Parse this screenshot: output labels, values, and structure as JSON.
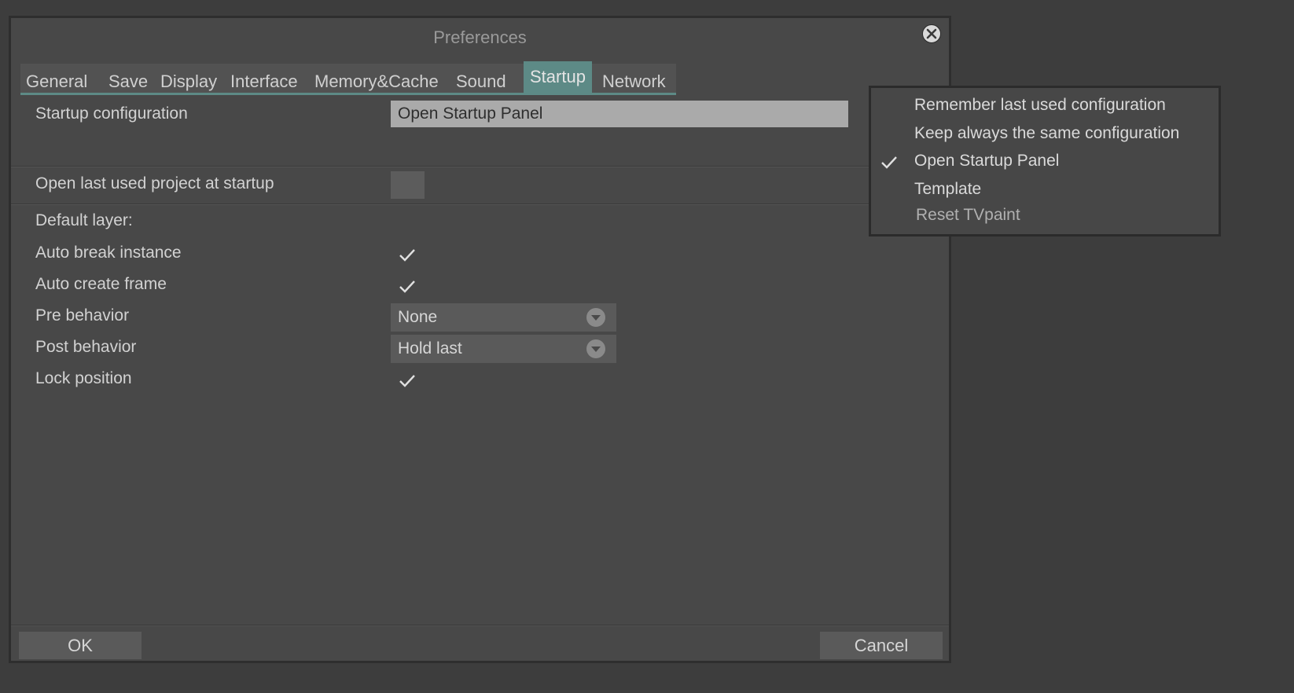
{
  "dialog": {
    "title": "Preferences"
  },
  "tabs": [
    {
      "label": "General",
      "active": false
    },
    {
      "label": "Save",
      "active": false
    },
    {
      "label": "Display",
      "active": false
    },
    {
      "label": "Interface",
      "active": false
    },
    {
      "label": "Memory&Cache",
      "active": false
    },
    {
      "label": "Sound",
      "active": false
    },
    {
      "label": "Startup",
      "active": true
    },
    {
      "label": "Network",
      "active": false
    }
  ],
  "startup": {
    "startup_configuration_label": "Startup configuration",
    "startup_configuration_value": "Open Startup Panel",
    "open_last_project_label": "Open last used project at startup",
    "open_last_project_checked": false,
    "default_layer_label": "Default layer:",
    "auto_break_instance_label": "Auto break instance",
    "auto_break_instance_checked": true,
    "auto_create_frame_label": "Auto create frame",
    "auto_create_frame_checked": true,
    "pre_behavior_label": "Pre behavior",
    "pre_behavior_value": "None",
    "post_behavior_label": "Post behavior",
    "post_behavior_value": "Hold last",
    "lock_position_label": "Lock position",
    "lock_position_checked": true
  },
  "footer": {
    "ok_label": "OK",
    "cancel_label": "Cancel"
  },
  "config_menu": {
    "items": [
      {
        "label": "Remember last used configuration",
        "checked": false
      },
      {
        "label": "Keep always the same configuration",
        "checked": false
      },
      {
        "label": "Open Startup Panel",
        "checked": true
      },
      {
        "label": "Template",
        "checked": false
      },
      {
        "label": "Reset TVpaint",
        "checked": false
      }
    ]
  },
  "colors": {
    "accent": "#5d8a86",
    "dialog_bg": "#484848",
    "desktop_bg": "#3d3d3d",
    "field_selected_bg": "#aaaaaa"
  },
  "icons": {
    "close": "close-circle-icon",
    "check": "checkmark-icon",
    "dropdown": "chevron-down-circle-icon"
  }
}
